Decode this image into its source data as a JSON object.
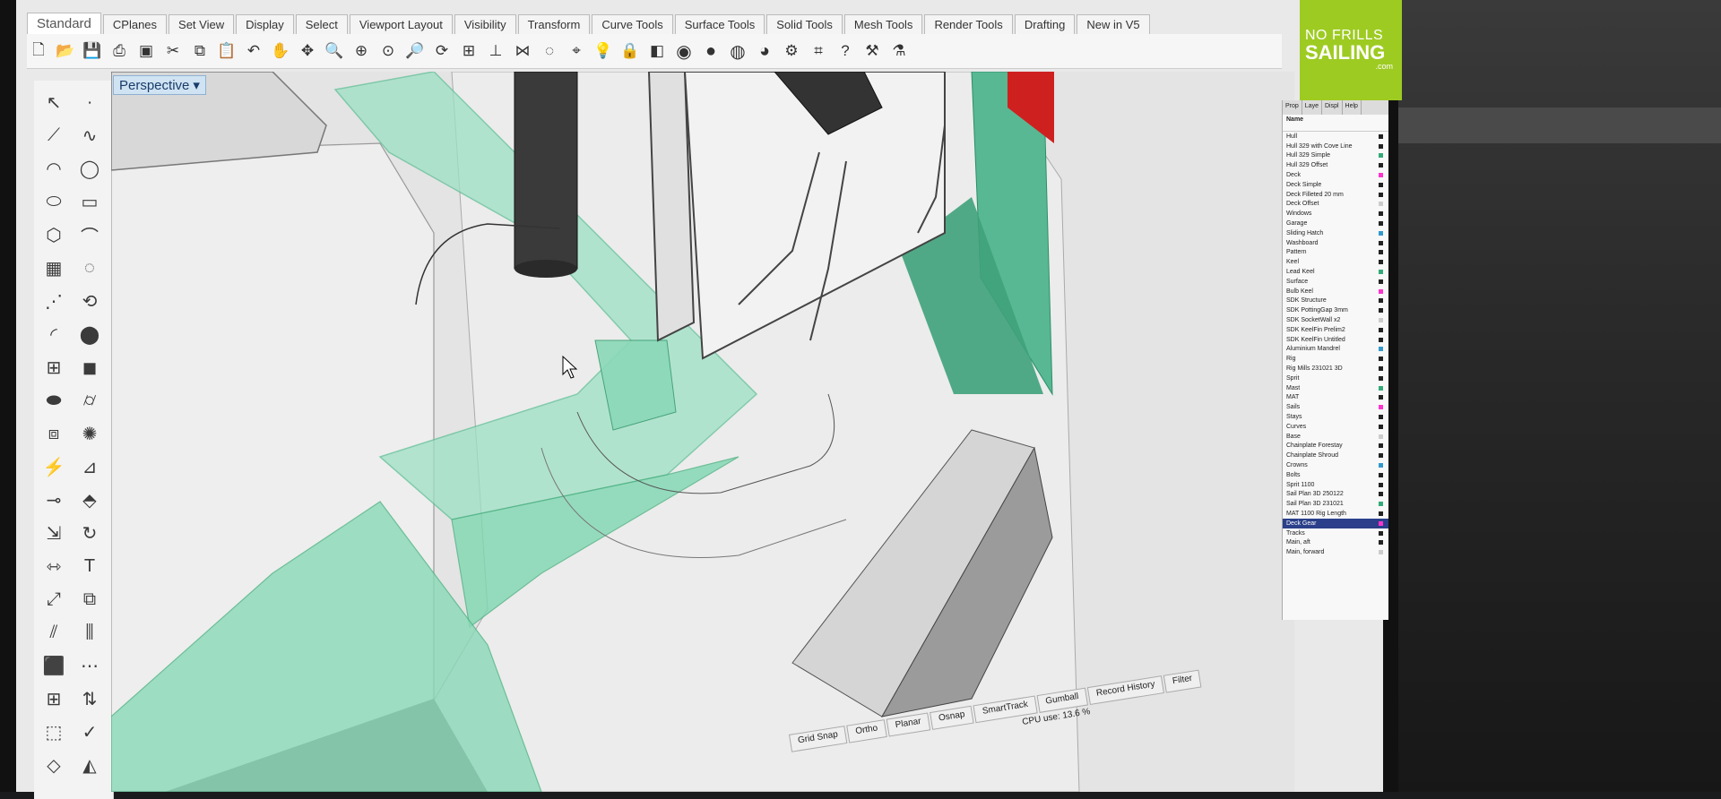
{
  "brand": {
    "line1": "NO FRILLS",
    "line2": "SAILING",
    "line3": ".com",
    "color": "#9ecb22"
  },
  "tabs": [
    "Standard",
    "CPlanes",
    "Set View",
    "Display",
    "Select",
    "Viewport Layout",
    "Visibility",
    "Transform",
    "Curve Tools",
    "Surface Tools",
    "Solid Tools",
    "Mesh Tools",
    "Render Tools",
    "Drafting",
    "New in V5"
  ],
  "viewport": {
    "label": "Perspective"
  },
  "panel": {
    "tabs": [
      "Prop",
      "Laye",
      "Displ",
      "Help"
    ],
    "header": "Name",
    "layers": [
      "Hull",
      "Hull 329 with Cove Line",
      "Hull 329 Simple",
      "Hull 329 Offset",
      "Deck",
      "Deck Simple",
      "Deck Filleted 20 mm",
      "Deck Offset",
      "Windows",
      "Garage",
      "Sliding Hatch",
      "Washboard",
      "Pattern",
      "Keel",
      "Lead Keel",
      "Surface",
      "Bulb Keel",
      "SDK Structure",
      "SDK PottingGap 3mm",
      "SDK SocketWall x2",
      "SDK KeelFin Prelim2",
      "SDK KeelFin Untitled",
      "Aluminium Mandrel",
      "Rig",
      "Rig Mills 231021 3D",
      "Sprit",
      "Mast",
      "MAT",
      "Sails",
      "Stays",
      "Curves",
      "Base",
      "Chainplate Forestay",
      "Chainplate Shroud",
      "Crowns",
      "Bolts",
      "Sprit 1100",
      "Sail Plan 3D 250122",
      "Sail Plan 3D 231021",
      "MAT 1100 Rig Length",
      "Deck Gear",
      "Tracks",
      "Main, aft",
      "Main, forward"
    ],
    "selected_layer": "Deck Gear"
  },
  "status": {
    "items": [
      "Grid Snap",
      "Ortho",
      "Planar",
      "Osnap",
      "SmartTrack",
      "Gumball",
      "Record History",
      "Filter"
    ],
    "cpu": "CPU use: 13.6 %"
  },
  "colors": {
    "accent_green": "#7fd8b2",
    "viewport_label_bg": "#cfe3f3",
    "selected_layer_bg": "#2b3f8a"
  }
}
